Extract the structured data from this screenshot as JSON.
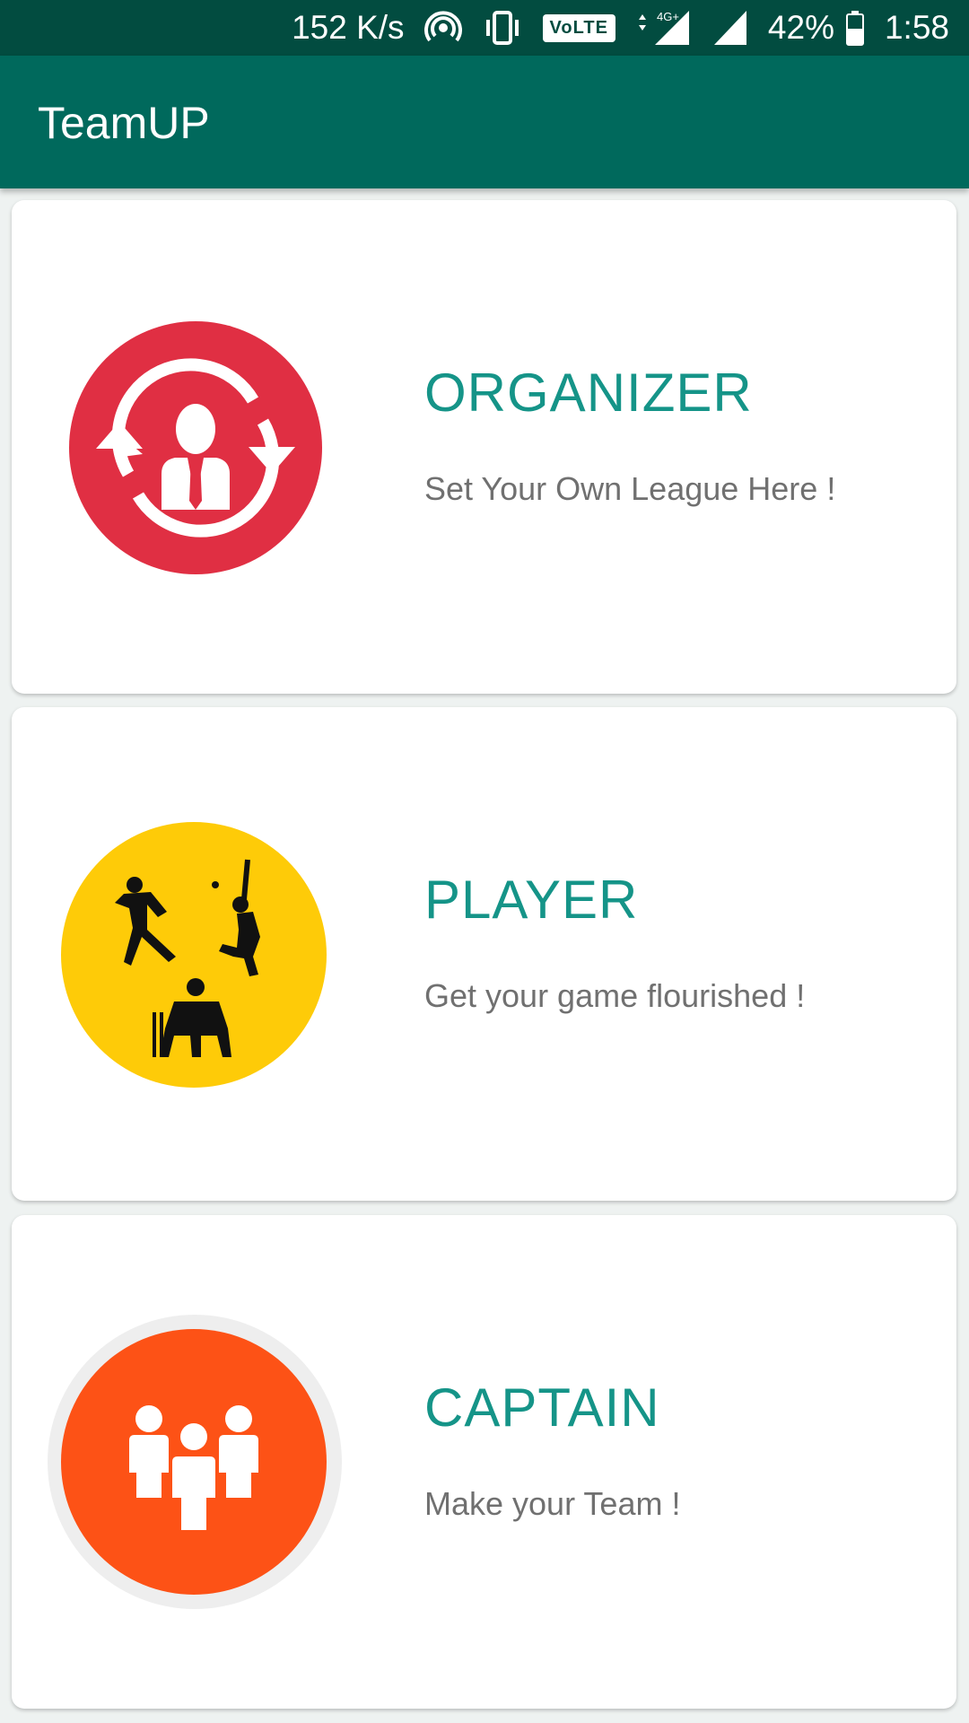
{
  "status_bar": {
    "net_speed": "152 K/s",
    "volte": "VoLTE",
    "network": "4G+",
    "battery": "42%",
    "time": "1:58",
    "icons": [
      "hotspot-icon",
      "vibrate-icon",
      "volte-icon",
      "signal-4g-icon",
      "signal-icon",
      "battery-icon"
    ]
  },
  "app_bar": {
    "title": "TeamUP",
    "color": "#00695c"
  },
  "cards": [
    {
      "title": "ORGANIZER",
      "subtitle": "Set Your Own League Here !",
      "icon": "organizer-icon",
      "icon_color": "#e02f43"
    },
    {
      "title": "PLAYER",
      "subtitle": "Get your game flourished !",
      "icon": "cricket-players-icon",
      "icon_color": "#fecb08"
    },
    {
      "title": "CAPTAIN",
      "subtitle": "Make your Team !",
      "icon": "team-icon",
      "icon_color": "#fd5216"
    }
  ],
  "colors": {
    "accent": "#159488",
    "status_bar": "#024c40",
    "subtitle_text": "#707070"
  }
}
